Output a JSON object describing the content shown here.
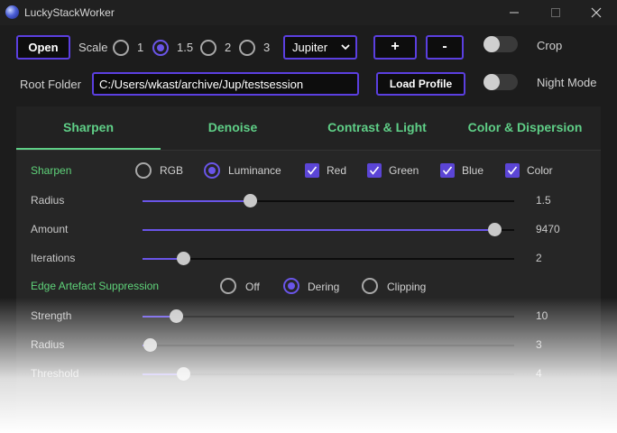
{
  "window": {
    "title": "LuckyStackWorker"
  },
  "toolbar": {
    "open_label": "Open",
    "scale_label": "Scale",
    "scale_options": [
      "1",
      "1.5",
      "2",
      "3"
    ],
    "scale_selected": "1.5",
    "planet_value": "Jupiter",
    "plus_label": "+",
    "minus_label": "-",
    "crop_label": "Crop",
    "root_folder_label": "Root Folder",
    "root_folder_value": "C:/Users/wkast/archive/Jup/testsession",
    "load_profile_label": "Load Profile",
    "night_mode_label": "Night Mode"
  },
  "tabs": [
    {
      "label": "Sharpen",
      "active": true
    },
    {
      "label": "Denoise",
      "active": false
    },
    {
      "label": "Contrast & Light",
      "active": false
    },
    {
      "label": "Color & Dispersion",
      "active": false
    }
  ],
  "sharpen": {
    "section_label": "Sharpen",
    "modes": [
      "RGB",
      "Luminance"
    ],
    "mode_selected": "Luminance",
    "channels": [
      {
        "label": "Red",
        "checked": true
      },
      {
        "label": "Green",
        "checked": true
      },
      {
        "label": "Blue",
        "checked": true
      },
      {
        "label": "Color",
        "checked": true
      }
    ],
    "sliders": [
      {
        "label": "Radius",
        "value": "1.5",
        "level": 0.29
      },
      {
        "label": "Amount",
        "value": "9470",
        "level": 0.947
      },
      {
        "label": "Iterations",
        "value": "2",
        "level": 0.11
      }
    ]
  },
  "edge": {
    "section_label": "Edge Artefact Suppression",
    "options": [
      "Off",
      "Dering",
      "Clipping"
    ],
    "selected": "Dering",
    "sliders": [
      {
        "label": "Strength",
        "value": "10",
        "level": 0.09
      },
      {
        "label": "Radius",
        "value": "3",
        "level": 0.02
      },
      {
        "label": "Threshold",
        "value": "4",
        "level": 0.11
      }
    ]
  },
  "colors": {
    "accent": "#5b3fe0",
    "green": "#5fcf87",
    "background": "#1c1c1c"
  }
}
